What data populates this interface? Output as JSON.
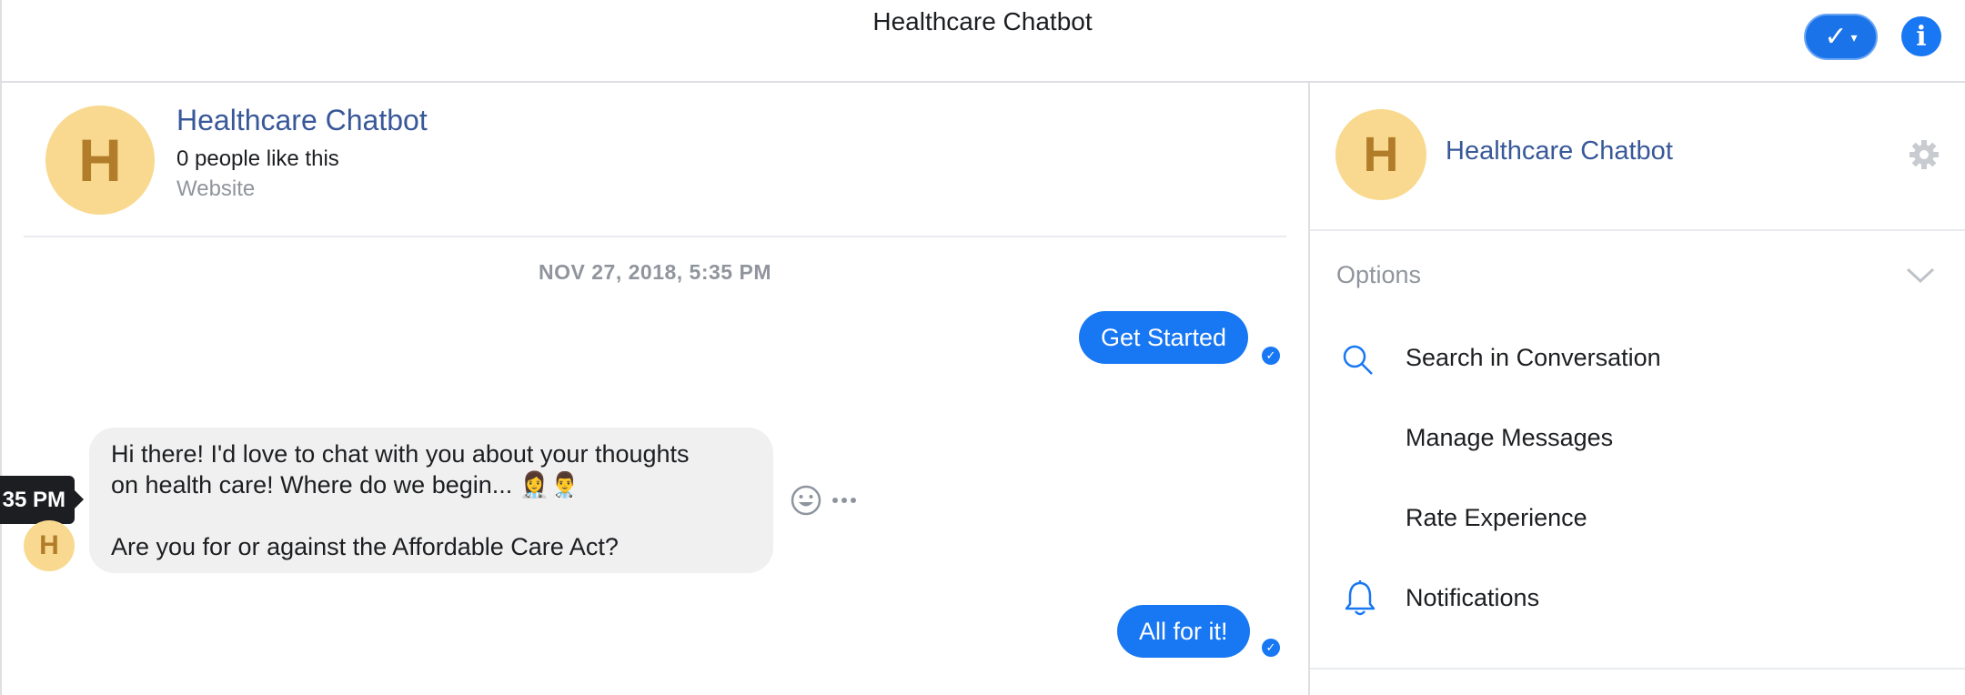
{
  "topbar": {
    "title": "Healthcare Chatbot",
    "status_check": "✓",
    "info_label": "i"
  },
  "page_header": {
    "avatar_letter": "H",
    "name": "Healthcare Chatbot",
    "likes": "0 people like this",
    "category": "Website"
  },
  "conversation": {
    "timestamp": "NOV 27, 2018, 5:35 PM",
    "hover_time": "35 PM",
    "messages": [
      {
        "from": "user",
        "text": "Get Started"
      },
      {
        "from": "bot",
        "line1": "Hi there! I'd love to chat with you about your thoughts",
        "line2": "on health care! Where do we begin... 👩‍⚕️👨‍⚕️",
        "line3": "Are you for or against the Affordable Care Act?"
      },
      {
        "from": "user",
        "text": "All for it!"
      }
    ],
    "bot_avatar_letter": "H"
  },
  "sidebar": {
    "avatar_letter": "H",
    "name": "Healthcare Chatbot",
    "options_label": "Options",
    "items": [
      {
        "label": "Search in Conversation",
        "icon": "search-icon"
      },
      {
        "label": "Manage Messages"
      },
      {
        "label": "Rate Experience"
      },
      {
        "label": "Notifications",
        "icon": "bell-icon"
      }
    ]
  },
  "colors": {
    "accent": "#1877f2",
    "avatar_bg": "#f8d98f",
    "avatar_fg": "#b27d2a",
    "link": "#385898"
  }
}
